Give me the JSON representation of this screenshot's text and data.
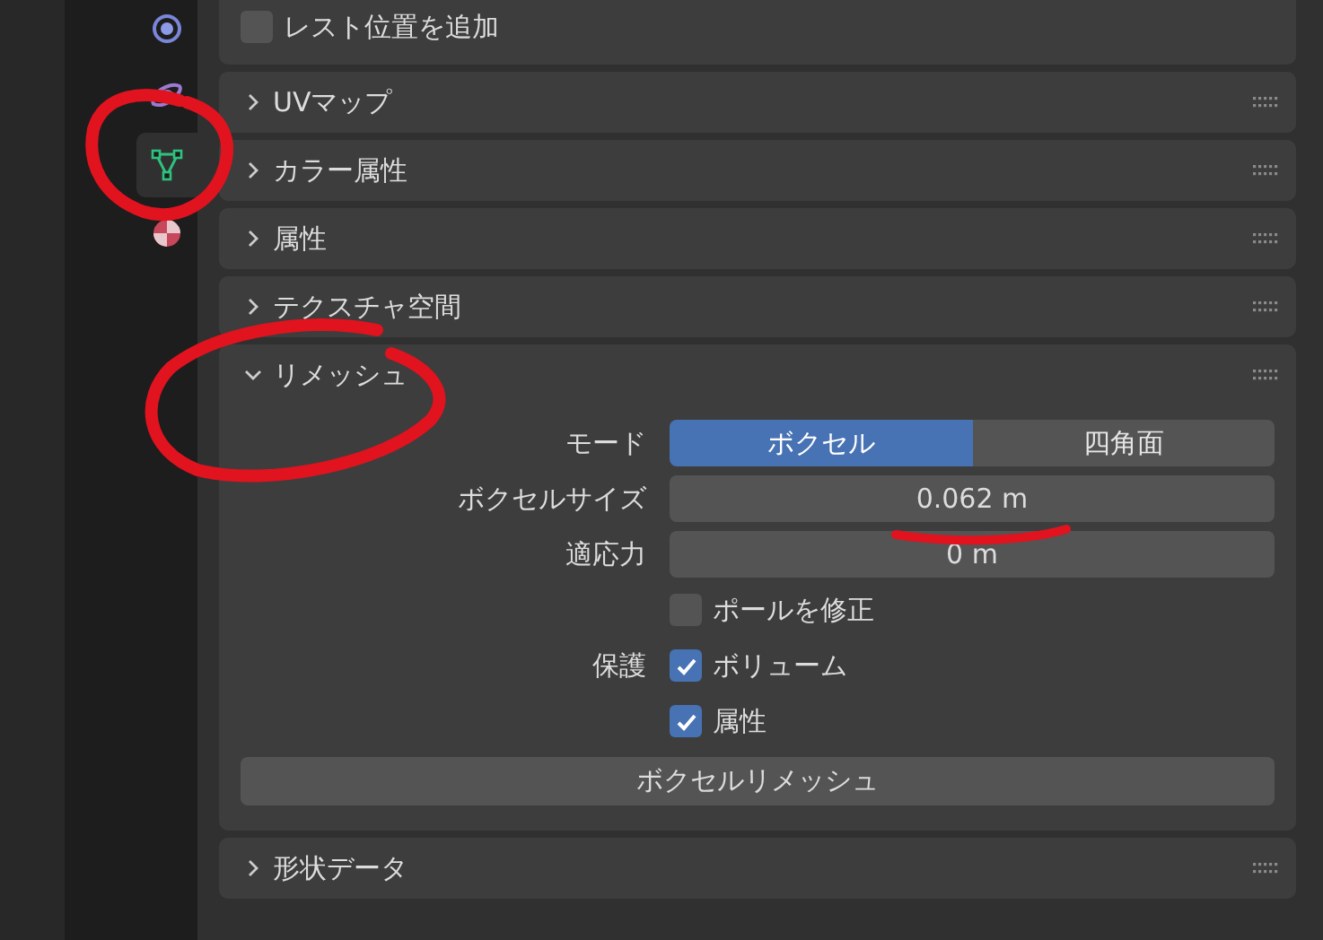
{
  "sidebar_tabs": [
    {
      "selected": false
    },
    {
      "selected": false
    },
    {
      "selected": true
    },
    {
      "selected": false
    }
  ],
  "top_panel": {
    "checkbox": {
      "label": "レスト位置を追加",
      "checked": false
    }
  },
  "panels": [
    {
      "title": "UVマップ",
      "expanded": false
    },
    {
      "title": "カラー属性",
      "expanded": false
    },
    {
      "title": "属性",
      "expanded": false
    },
    {
      "title": "テクスチャ空間",
      "expanded": false
    },
    {
      "title": "リメッシュ",
      "expanded": true,
      "mode": {
        "label": "モード",
        "options": [
          {
            "label": "ボクセル",
            "selected": true
          },
          {
            "label": "四角面",
            "selected": false
          }
        ]
      },
      "fields": [
        {
          "label": "ボクセルサイズ",
          "value": "0.062 m"
        },
        {
          "label": "適応力",
          "value": "0 m"
        }
      ],
      "fix_poles": {
        "label": "ポールを修正",
        "checked": false
      },
      "preserve": {
        "label": "保護",
        "options": [
          {
            "label": "ボリューム",
            "checked": true
          },
          {
            "label": "属性",
            "checked": true
          }
        ]
      },
      "button": "ボクセルリメッシュ"
    },
    {
      "title": "形状データ",
      "expanded": false
    }
  ]
}
